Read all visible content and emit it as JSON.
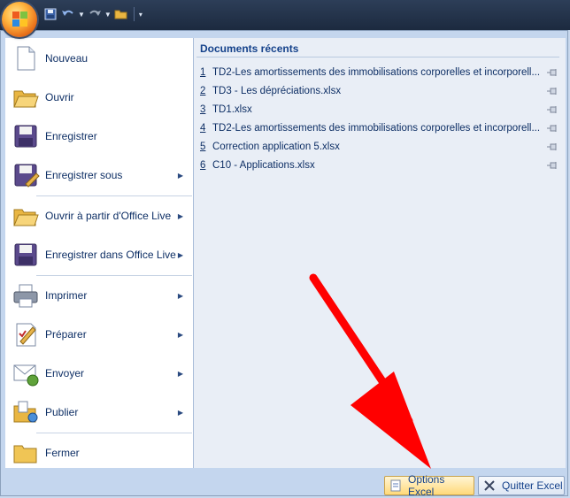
{
  "menu": {
    "items": [
      {
        "label": "Nouveau",
        "icon": "new-document-icon",
        "arrow": false
      },
      {
        "label": "Ouvrir",
        "icon": "open-folder-icon",
        "arrow": false
      },
      {
        "label": "Enregistrer",
        "icon": "save-icon",
        "arrow": false
      },
      {
        "label": "Enregistrer sous",
        "icon": "save-as-icon",
        "arrow": true
      },
      {
        "label": "Ouvrir à partir d'Office Live",
        "icon": "open-office-live-icon",
        "arrow": true
      },
      {
        "label": "Enregistrer dans Office Live",
        "icon": "save-office-live-icon",
        "arrow": true
      },
      {
        "label": "Imprimer",
        "icon": "print-icon",
        "arrow": true
      },
      {
        "label": "Préparer",
        "icon": "prepare-icon",
        "arrow": true
      },
      {
        "label": "Envoyer",
        "icon": "send-icon",
        "arrow": true
      },
      {
        "label": "Publier",
        "icon": "publish-icon",
        "arrow": true
      },
      {
        "label": "Fermer",
        "icon": "close-folder-icon",
        "arrow": false
      }
    ]
  },
  "recent": {
    "title": "Documents récents",
    "docs": [
      {
        "num": "1",
        "name": "TD2-Les amortissements des immobilisations corporelles et incorporell..."
      },
      {
        "num": "2",
        "name": "TD3 - Les dépréciations.xlsx"
      },
      {
        "num": "3",
        "name": "TD1.xlsx"
      },
      {
        "num": "4",
        "name": "TD2-Les amortissements des immobilisations corporelles et incorporell..."
      },
      {
        "num": "5",
        "name": "Correction application 5.xlsx"
      },
      {
        "num": "6",
        "name": "C10 - Applications.xlsx"
      }
    ]
  },
  "footer": {
    "options_label": "Options Excel",
    "quit_label": "Quitter Excel"
  },
  "colors": {
    "titlebar": "#1c2a3f",
    "menu_bg": "#c4d6ee",
    "accent_orange": "#e8701a",
    "arrow_red": "#ff0000"
  }
}
